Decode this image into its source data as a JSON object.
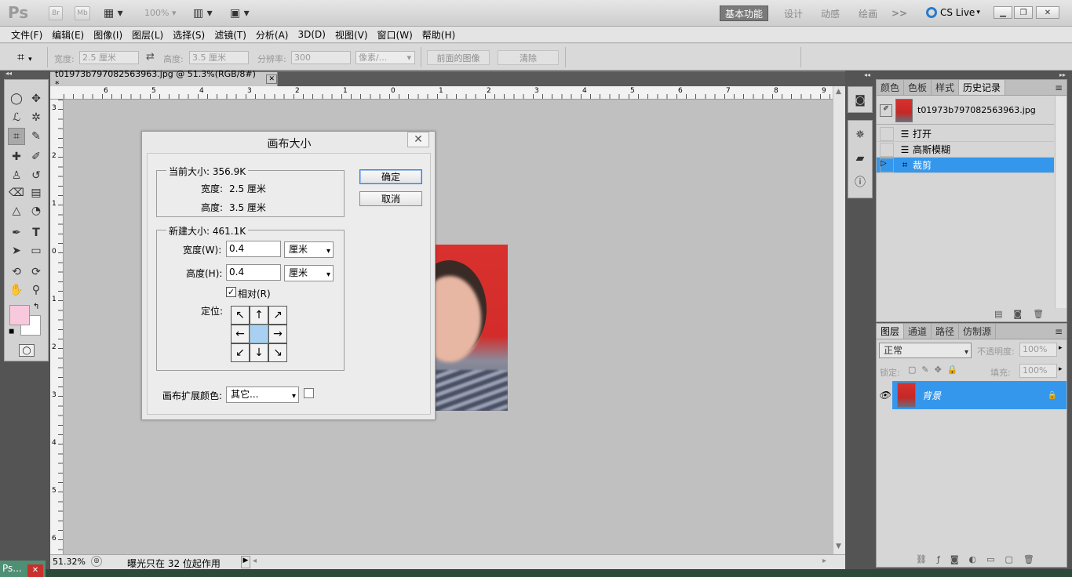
{
  "app": {
    "logo": "Ps",
    "zoom": "100%"
  },
  "workspaces": [
    "基本功能",
    "设计",
    "动感",
    "绘画"
  ],
  "more": ">>",
  "cslive": "CS Live",
  "menu": [
    "文件(F)",
    "编辑(E)",
    "图像(I)",
    "图层(L)",
    "选择(S)",
    "滤镜(T)",
    "分析(A)",
    "3D(D)",
    "视图(V)",
    "窗口(W)",
    "帮助(H)"
  ],
  "options": {
    "width_label": "宽度:",
    "width_value": "2.5 厘米",
    "height_label": "高度:",
    "height_value": "3.5 厘米",
    "res_label": "分辨率:",
    "res_value": "300",
    "unit": "像素/...",
    "front_image": "前面的图像",
    "clear": "清除"
  },
  "document": {
    "tab_title": "t01973b797082563963.jpg @ 51.3%(RGB/8#) *"
  },
  "ruler_h": [
    "6",
    "5",
    "4",
    "3",
    "2",
    "1",
    "0",
    "1",
    "2",
    "3",
    "4",
    "5",
    "6",
    "7",
    "8",
    "9"
  ],
  "ruler_v": [
    "3",
    "2",
    "1",
    "0",
    "1",
    "2",
    "3",
    "4",
    "5",
    "6"
  ],
  "status": {
    "zoom": "51.32%",
    "text": "曝光只在 32 位起作用"
  },
  "dialog": {
    "title": "画布大小",
    "current_size_label": "当前大小: 356.9K",
    "cur_width_label": "宽度:",
    "cur_width_value": "2.5 厘米",
    "cur_height_label": "高度:",
    "cur_height_value": "3.5 厘米",
    "new_size_label": "新建大小: 461.1K",
    "new_width_label": "宽度(W):",
    "new_width_value": "0.4",
    "new_width_unit": "厘米",
    "new_height_label": "高度(H):",
    "new_height_value": "0.4",
    "new_height_unit": "厘米",
    "relative_label": "相对(R)",
    "anchor_label": "定位:",
    "ext_color_label": "画布扩展颜色:",
    "ext_color_value": "其它...",
    "ok": "确定",
    "cancel": "取消"
  },
  "history_panel": {
    "tabs": [
      "颜色",
      "色板",
      "样式",
      "历史记录"
    ],
    "snapshot": "t01973b797082563963.jpg",
    "items": [
      "打开",
      "高斯模糊",
      "裁剪"
    ]
  },
  "layers_panel": {
    "tabs": [
      "图层",
      "通道",
      "路径",
      "仿制源"
    ],
    "blend_mode": "正常",
    "opacity_label": "不透明度:",
    "opacity_value": "100%",
    "lock_label": "锁定:",
    "fill_label": "填充:",
    "fill_value": "100%",
    "layer_name": "背景"
  },
  "taskbar": {
    "label": "Ps..."
  },
  "colors": {
    "accent": "#3597ec",
    "photo_red": "#d32c2a",
    "foreground": "#f8c9dd"
  }
}
